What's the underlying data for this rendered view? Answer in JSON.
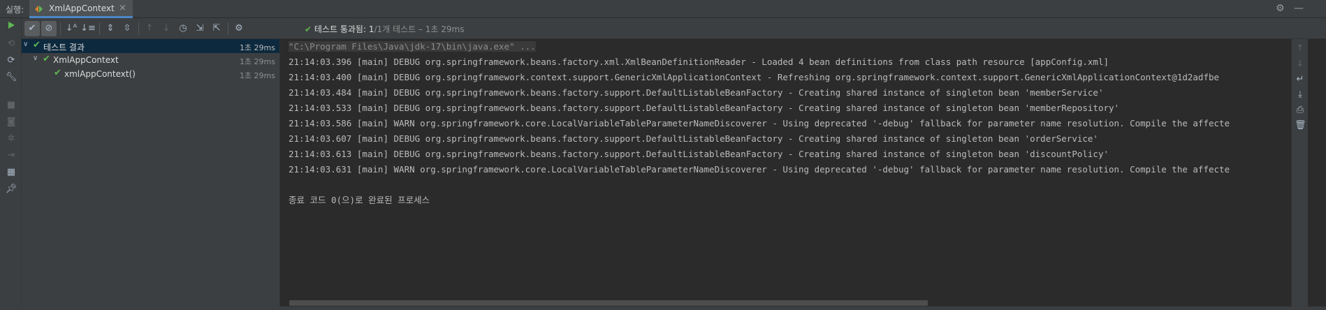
{
  "header": {
    "run_label": "실행:",
    "tab_title": "XmlAppContext",
    "tab_close": "×"
  },
  "toolbar": {
    "status_text": "테스트 통과됨:",
    "status_count": "1",
    "status_detail": "/1개 테스트 – 1초 29ms"
  },
  "tree": {
    "items": [
      {
        "name": "테스트 결과",
        "time": "1초 29ms"
      },
      {
        "name": "XmlAppContext",
        "time": "1초 29ms"
      },
      {
        "name": "xmlAppContext()",
        "time": "1초 29ms"
      }
    ]
  },
  "console": {
    "lines": [
      "\"C:\\Program Files\\Java\\jdk-17\\bin\\java.exe\" ...",
      "21:14:03.396 [main] DEBUG org.springframework.beans.factory.xml.XmlBeanDefinitionReader - Loaded 4 bean definitions from class path resource [appConfig.xml]",
      "21:14:03.400 [main] DEBUG org.springframework.context.support.GenericXmlApplicationContext - Refreshing org.springframework.context.support.GenericXmlApplicationContext@1d2adfbe",
      "21:14:03.484 [main] DEBUG org.springframework.beans.factory.support.DefaultListableBeanFactory - Creating shared instance of singleton bean 'memberService'",
      "21:14:03.533 [main] DEBUG org.springframework.beans.factory.support.DefaultListableBeanFactory - Creating shared instance of singleton bean 'memberRepository'",
      "21:14:03.586 [main] WARN org.springframework.core.LocalVariableTableParameterNameDiscoverer - Using deprecated '-debug' fallback for parameter name resolution. Compile the affecte",
      "21:14:03.607 [main] DEBUG org.springframework.beans.factory.support.DefaultListableBeanFactory - Creating shared instance of singleton bean 'orderService'",
      "21:14:03.613 [main] DEBUG org.springframework.beans.factory.support.DefaultListableBeanFactory - Creating shared instance of singleton bean 'discountPolicy'",
      "21:14:03.631 [main] WARN org.springframework.core.LocalVariableTableParameterNameDiscoverer - Using deprecated '-debug' fallback for parameter name resolution. Compile the affecte",
      "",
      "종료 코드 0(으)로 완료된 프로세스"
    ]
  },
  "icons": {
    "run": "play-icon",
    "pass_filter": "check-icon",
    "ignored_filter": "no-entry-icon",
    "settings": "gear-icon",
    "minimize": "minimize-icon"
  },
  "colors": {
    "pass_green": "#5fb653",
    "selection": "#0d293e",
    "tab_underline": "#4a88c7"
  }
}
